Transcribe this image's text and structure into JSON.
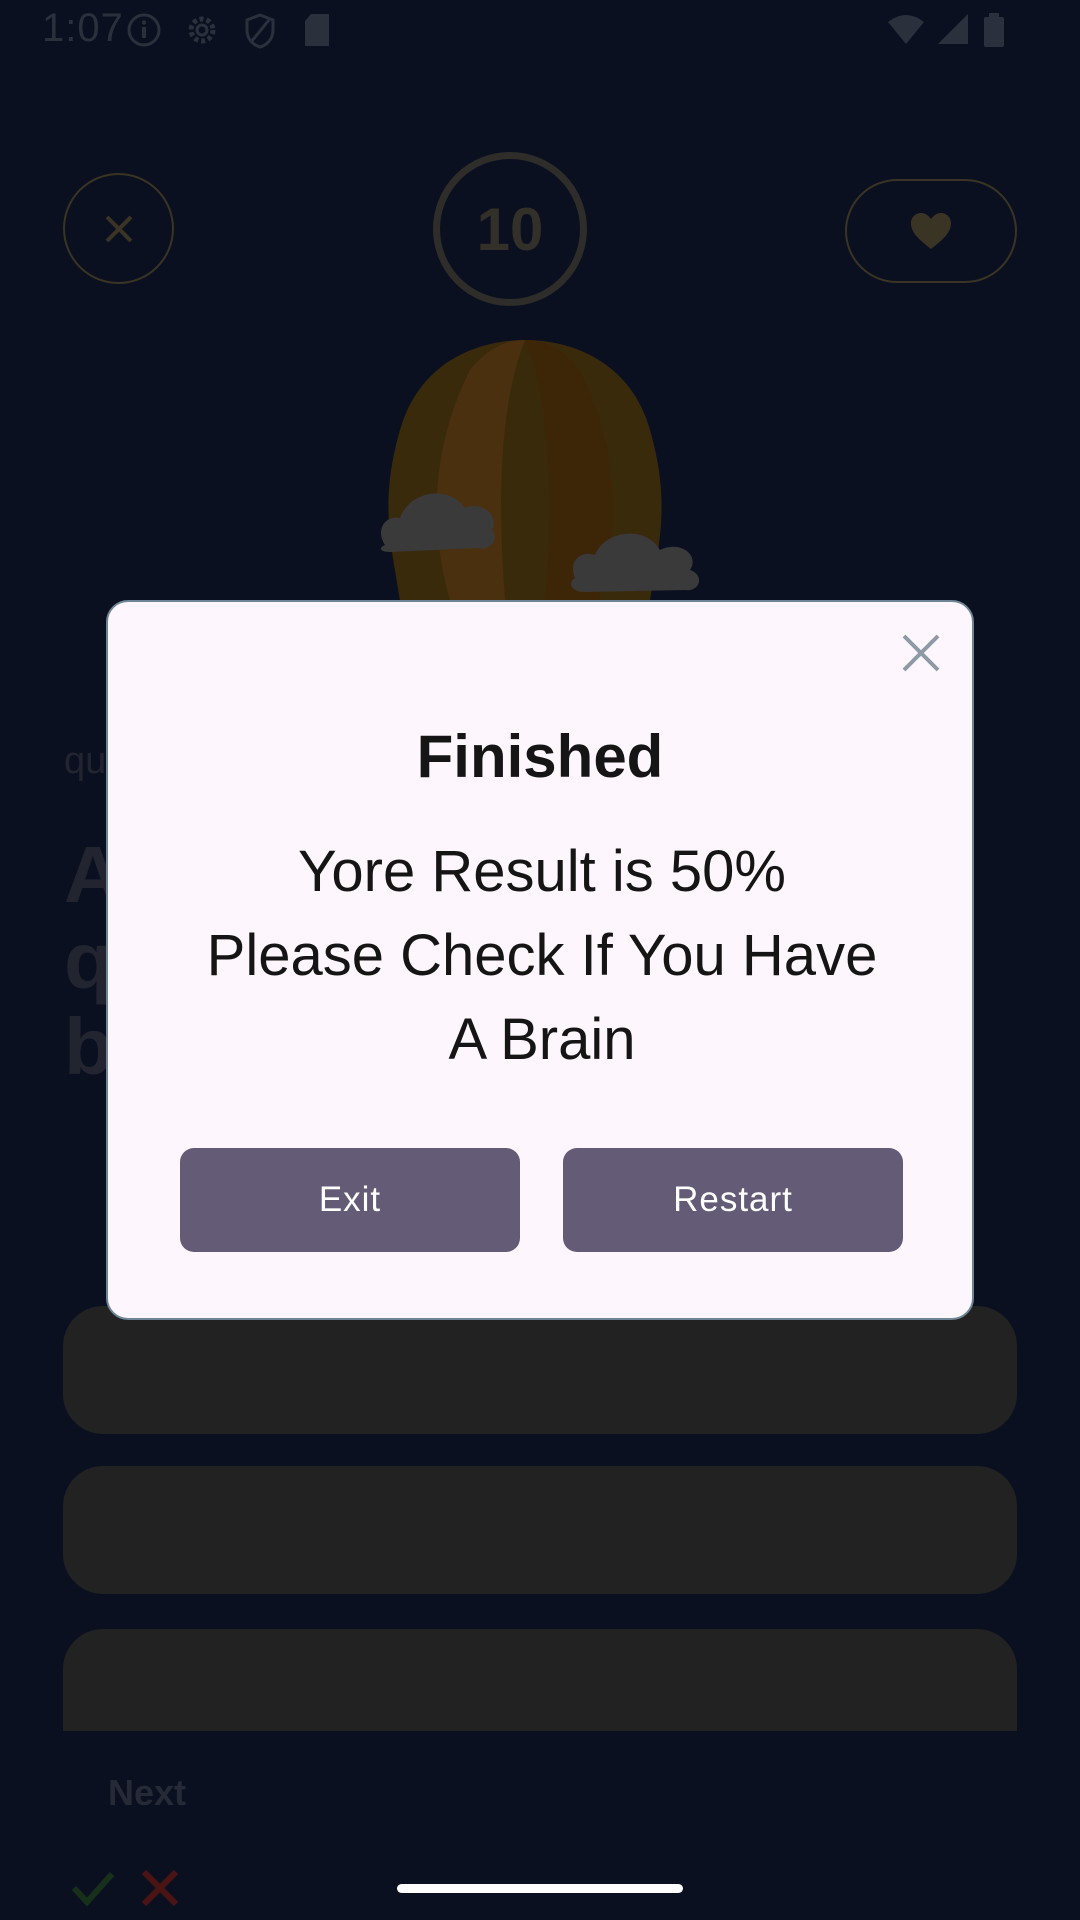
{
  "status_bar": {
    "time": "1:07",
    "left_icons": [
      "info-icon",
      "settings-icon",
      "shield-icon",
      "sd-card-icon"
    ],
    "right_icons": [
      "wifi-icon",
      "signal-icon",
      "battery-icon"
    ]
  },
  "quiz": {
    "close_icon": "close-icon",
    "timer": "10",
    "favorite_icon": "heart-icon",
    "question_label": "qu",
    "question_lines": [
      "A",
      "q",
      "b"
    ],
    "next_label": "Next",
    "mark_icons": [
      "check-icon",
      "cross-icon"
    ]
  },
  "dialog": {
    "title": "Finished",
    "message_lines": [
      "Yore Result is 50%",
      "Please Check If You Have",
      "A Brain"
    ],
    "exit_label": "Exit",
    "restart_label": "Restart",
    "close_icon": "close-icon"
  },
  "colors": {
    "background": "#0b1020",
    "dialog_bg": "#fdf6fc",
    "button": "#645c77",
    "answer_bg": "#222222"
  }
}
